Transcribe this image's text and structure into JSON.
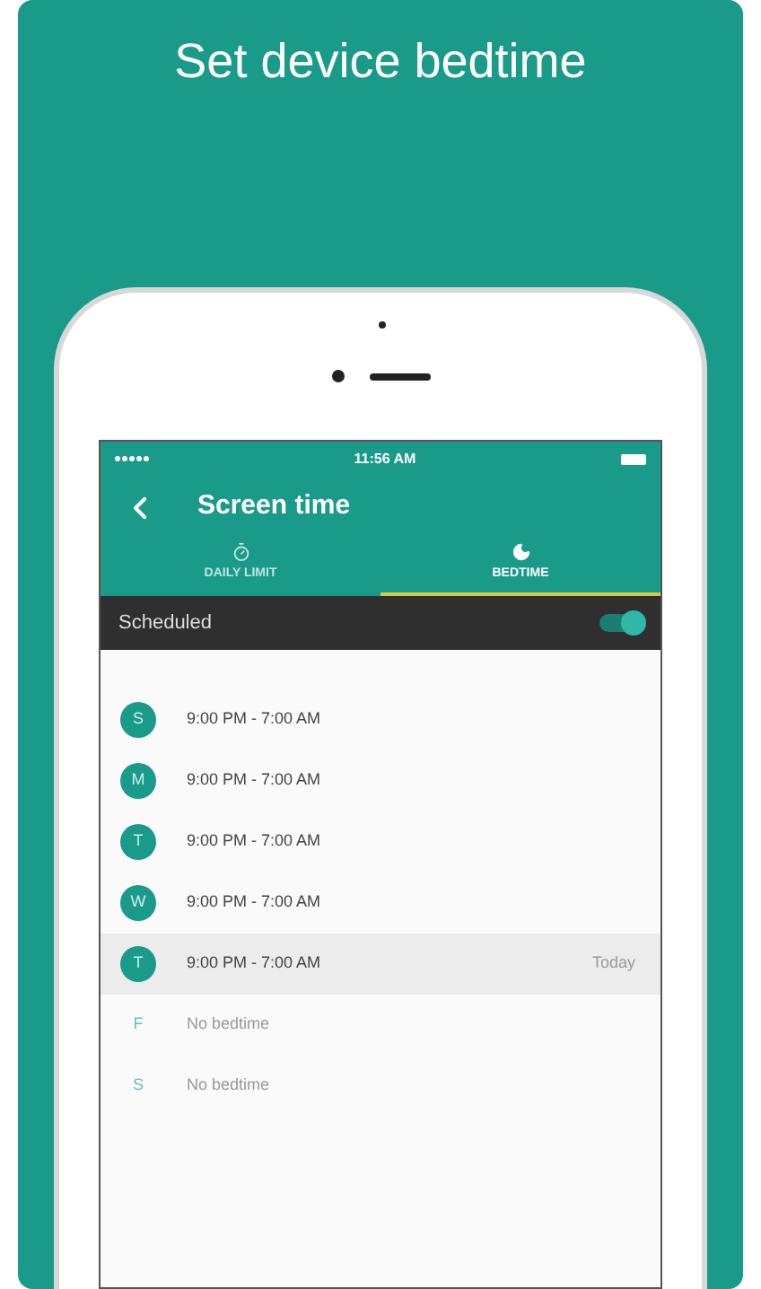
{
  "banner": {
    "title": "Set device bedtime"
  },
  "status_bar": {
    "time": "11:56 AM"
  },
  "app_bar": {
    "title": "Screen time"
  },
  "tabs": [
    {
      "label": "DAILY LIMIT",
      "kind": "timer",
      "selected": false
    },
    {
      "label": "BEDTIME",
      "kind": "moon",
      "selected": true
    }
  ],
  "schedule_toggle": {
    "label": "Scheduled",
    "on": true
  },
  "days": [
    {
      "letter": "S",
      "time": "9:00 PM - 7:00 AM",
      "enabled": true,
      "selected": false
    },
    {
      "letter": "M",
      "time": "9:00 PM - 7:00 AM",
      "enabled": true,
      "selected": false
    },
    {
      "letter": "T",
      "time": "9:00 PM - 7:00 AM",
      "enabled": true,
      "selected": false
    },
    {
      "letter": "W",
      "time": "9:00 PM - 7:00 AM",
      "enabled": true,
      "selected": false
    },
    {
      "letter": "T",
      "time": "9:00 PM - 7:00 AM",
      "enabled": true,
      "selected": true,
      "note": "Today"
    },
    {
      "letter": "F",
      "time": "No bedtime",
      "enabled": false,
      "selected": false
    },
    {
      "letter": "S",
      "time": "No bedtime",
      "enabled": false,
      "selected": false
    }
  ]
}
